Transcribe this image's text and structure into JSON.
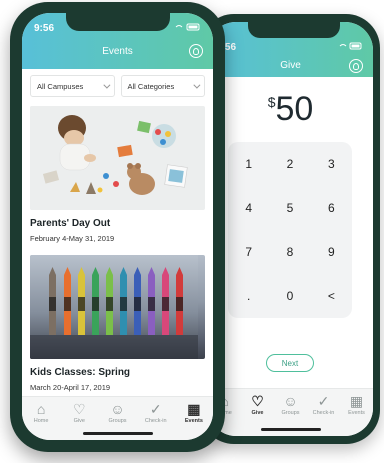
{
  "give_screen": {
    "status_time": "9:56",
    "title": "Give",
    "currency": "$",
    "amount": "50",
    "keypad": [
      "1",
      "2",
      "3",
      "4",
      "5",
      "6",
      "7",
      "8",
      "9",
      ".",
      "0",
      "<"
    ],
    "next_label": "Next",
    "tabs": [
      {
        "label": "Home",
        "icon": "home-icon"
      },
      {
        "label": "Give",
        "icon": "give-icon",
        "active": true
      },
      {
        "label": "Groups",
        "icon": "groups-icon"
      },
      {
        "label": "Check-in",
        "icon": "check-in-icon"
      },
      {
        "label": "Events",
        "icon": "events-icon"
      }
    ]
  },
  "events_screen": {
    "status_time": "9:56",
    "title": "Events",
    "filters": {
      "campus": "All Campuses",
      "category": "All Categories"
    },
    "events": [
      {
        "title": "Parents' Day Out",
        "date": "February 4-May 31, 2019"
      },
      {
        "title": "Kids Classes: Spring",
        "date": "March 20-April 17, 2019"
      }
    ],
    "tabs": [
      {
        "label": "Home",
        "icon": "home-icon"
      },
      {
        "label": "Give",
        "icon": "give-icon"
      },
      {
        "label": "Groups",
        "icon": "groups-icon"
      },
      {
        "label": "Check-in",
        "icon": "check-in-icon"
      },
      {
        "label": "Events",
        "icon": "events-icon",
        "active": true
      }
    ]
  },
  "colors": {
    "header_gradient_start": "#58c0d8",
    "header_gradient_end": "#5fc9a6",
    "phone_frame": "#1c3a30",
    "accent": "#4fbf9c"
  }
}
